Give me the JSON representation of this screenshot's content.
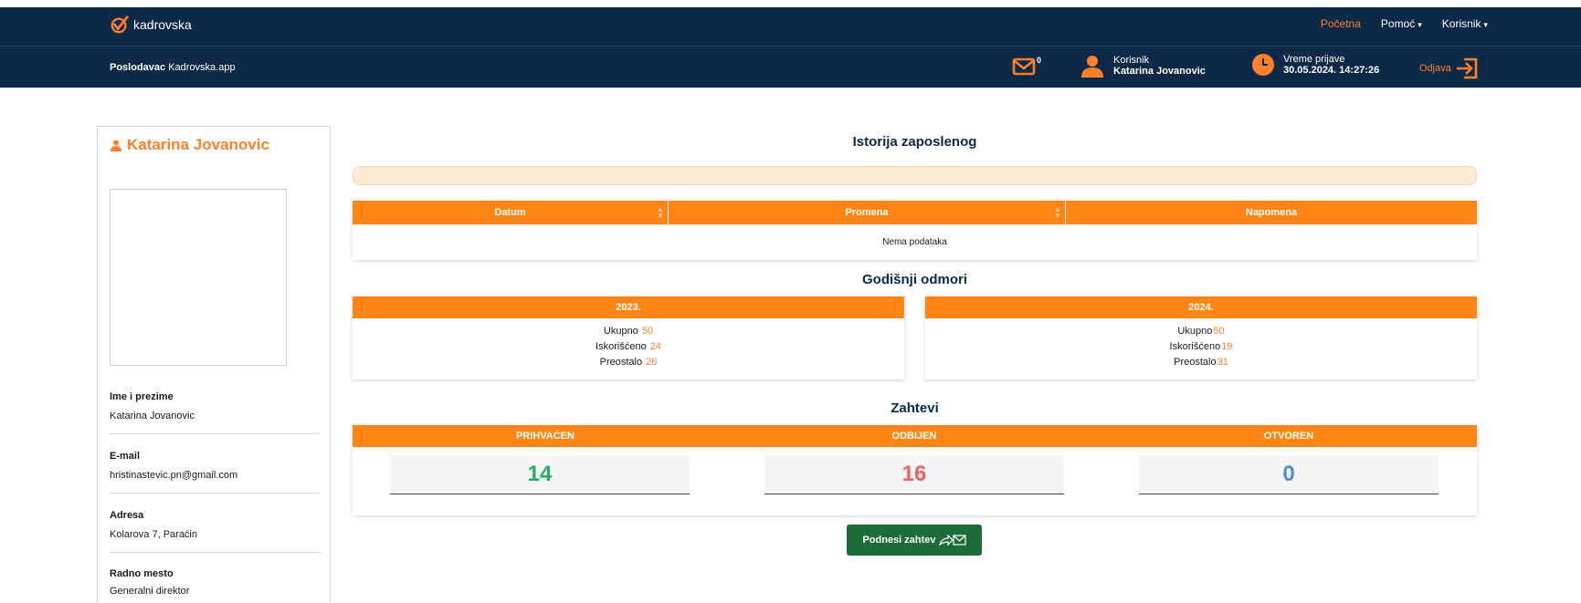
{
  "app": {
    "brand": "kadrovska",
    "nav": {
      "home": "Početna",
      "help": "Pomoć",
      "user_menu": "Korisnik"
    },
    "subbar": {
      "employer_label": "Poslodavac",
      "employer_value": "Kadrovska.app",
      "mail_count": "0",
      "user_label": "Korisnik",
      "user_name": "Katarina Jovanovic",
      "login_label": "Vreme prijave",
      "login_time": "30.05.2024. 14:27:26",
      "logout": "Odjava"
    }
  },
  "profile": {
    "name": "Katarina Jovanovic",
    "fields": [
      {
        "label": "Ime i prezime",
        "value": "Katarina Jovanovic"
      },
      {
        "label": "E-mail",
        "value": "hristinastevic.pn@gmail.com"
      },
      {
        "label": "Adresa",
        "value": "Kolarova 7, Paraćin"
      },
      {
        "label": "Radno mesto",
        "value": "Generalni direktor"
      }
    ]
  },
  "history": {
    "title": "Istorija zaposlenog",
    "columns": [
      "Datum",
      "Promena",
      "Napomena"
    ],
    "empty_text": "Nema podataka"
  },
  "vacations": {
    "title": "Godišnji odmori",
    "labels": {
      "total": "Ukupno",
      "used": "Iskorišćeno",
      "left": "Preostalo"
    },
    "years": [
      {
        "year": "2023.",
        "total": "50",
        "used": "24",
        "left": "26"
      },
      {
        "year": "2024.",
        "total": "50",
        "used": "19",
        "left": "31"
      }
    ]
  },
  "requests": {
    "title": "Zahtevi",
    "statuses": [
      {
        "label": "PRIHVAĆEN",
        "count": "14",
        "color": "#27ae60"
      },
      {
        "label": "ODBIJEN",
        "count": "16",
        "color": "#f0606a"
      },
      {
        "label": "OTVOREN",
        "count": "0",
        "color": "#4a8fd8"
      }
    ],
    "submit_label": "Podnesi zahtev"
  },
  "colors": {
    "navy": "#0c2a47",
    "orange": "#ff8614",
    "accent": "#ff7f2a",
    "submit_green": "#1e6b3a"
  }
}
